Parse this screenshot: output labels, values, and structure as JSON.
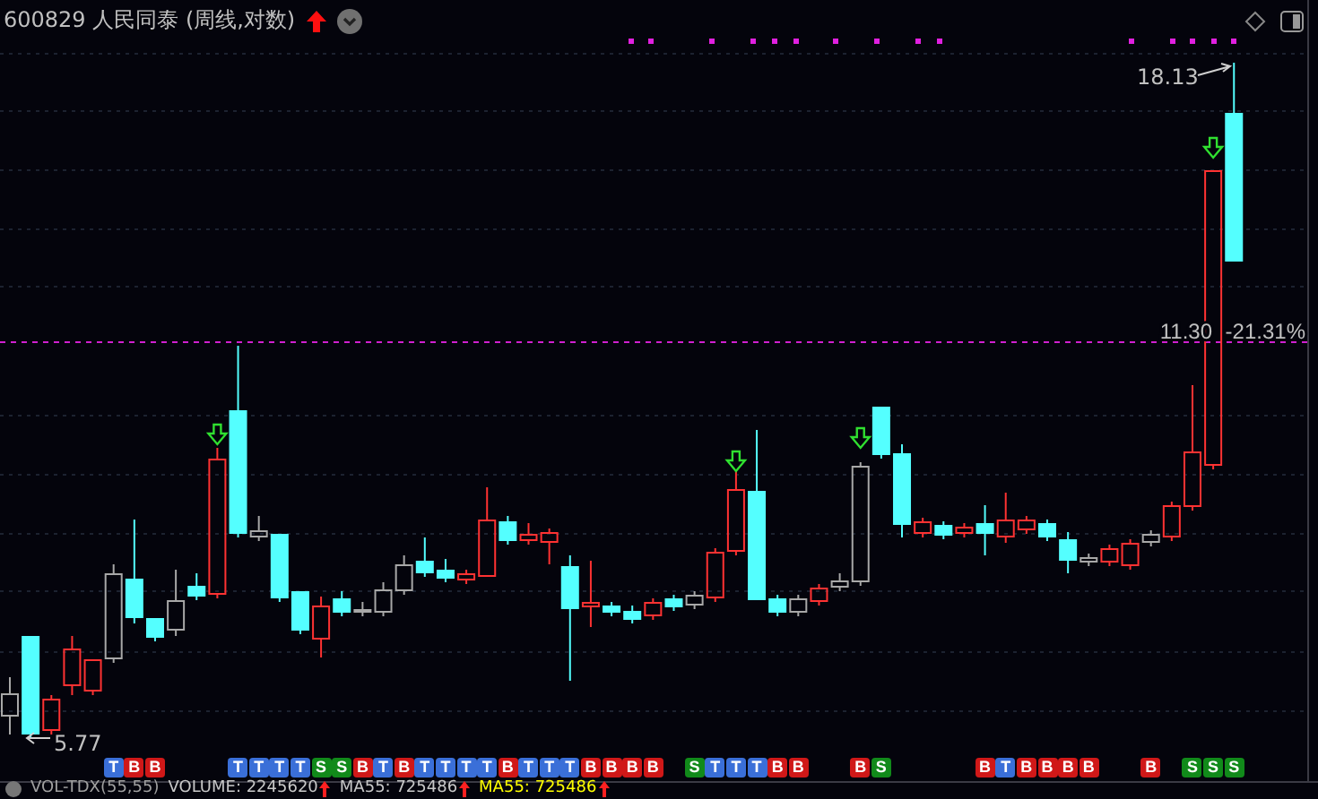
{
  "header": {
    "title": "600829 人民同泰 (周线,对数)"
  },
  "chart": {
    "high_label": "18.13",
    "low_label": "5.77",
    "reference_line": {
      "price": "11.30",
      "change": "-21.31%"
    }
  },
  "signals": [
    {
      "label": "T",
      "kind": "trend"
    },
    {
      "label": "B",
      "kind": "buy"
    },
    {
      "label": "B",
      "kind": "buy"
    },
    {
      "label": "T",
      "kind": "trend"
    },
    {
      "label": "T",
      "kind": "trend"
    },
    {
      "label": "T",
      "kind": "trend"
    },
    {
      "label": "T",
      "kind": "trend"
    },
    {
      "label": "S",
      "kind": "sell"
    },
    {
      "label": "S",
      "kind": "sell"
    },
    {
      "label": "B",
      "kind": "buy"
    },
    {
      "label": "T",
      "kind": "trend"
    },
    {
      "label": "B",
      "kind": "buy"
    },
    {
      "label": "T",
      "kind": "trend"
    },
    {
      "label": "T",
      "kind": "trend"
    },
    {
      "label": "T",
      "kind": "trend"
    },
    {
      "label": "T",
      "kind": "trend"
    },
    {
      "label": "B",
      "kind": "buy"
    },
    {
      "label": "T",
      "kind": "trend"
    },
    {
      "label": "T",
      "kind": "trend"
    },
    {
      "label": "T",
      "kind": "trend"
    },
    {
      "label": "B",
      "kind": "buy"
    },
    {
      "label": "B",
      "kind": "buy"
    },
    {
      "label": "B",
      "kind": "buy"
    },
    {
      "label": "B",
      "kind": "buy"
    },
    {
      "label": "S",
      "kind": "sell"
    },
    {
      "label": "T",
      "kind": "trend"
    },
    {
      "label": "T",
      "kind": "trend"
    },
    {
      "label": "T",
      "kind": "trend"
    },
    {
      "label": "B",
      "kind": "buy"
    },
    {
      "label": "B",
      "kind": "buy"
    },
    {
      "label": "B",
      "kind": "buy"
    },
    {
      "label": "S",
      "kind": "sell"
    },
    {
      "label": "B",
      "kind": "buy"
    },
    {
      "label": "T",
      "kind": "trend"
    },
    {
      "label": "B",
      "kind": "buy"
    },
    {
      "label": "B",
      "kind": "buy"
    },
    {
      "label": "B",
      "kind": "buy"
    },
    {
      "label": "B",
      "kind": "buy"
    },
    {
      "label": "B",
      "kind": "buy"
    },
    {
      "label": "S",
      "kind": "sell"
    },
    {
      "label": "S",
      "kind": "sell"
    },
    {
      "label": "S",
      "kind": "sell"
    }
  ],
  "indicator_bar": {
    "name": "VOL-TDX(55,55)",
    "values": [
      {
        "text": "VOLUME: 2245620",
        "color": "#c8c8c8"
      },
      {
        "text": "MA55: 725486",
        "color": "#c8c8c8"
      },
      {
        "text": "MA55: 725486",
        "color": "#ffff00"
      }
    ]
  }
}
